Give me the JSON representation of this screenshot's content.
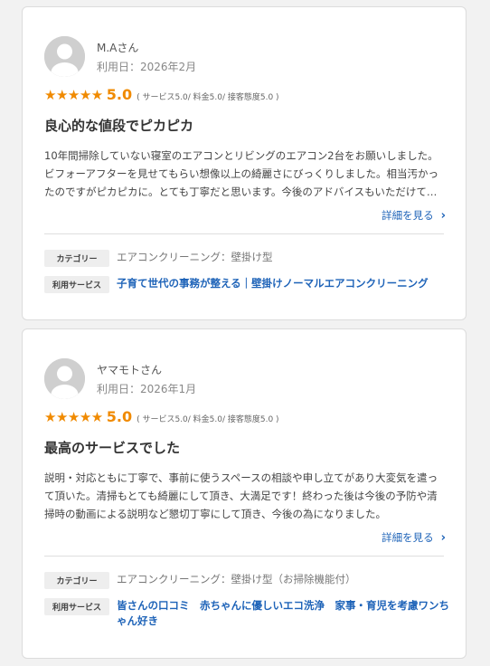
{
  "reviews": [
    {
      "name": "M.Aさん",
      "date": "利用日：2026年2月",
      "stars": "★★★★★",
      "score": "5.0",
      "sub_scores": "( サービス5.0/ 料金5.0/ 接客態度5.0 )",
      "title": "良心的な値段でピカピカ",
      "body": "10年間掃除していない寝室のエアコンとリビングのエアコン2台をお願いしました。ビフォーアフターを見せてもらい想像以上の綺麗さにびっくりしました。相当汚かったのですがピカピカに。とても丁寧だと思います。今後のアドバイスもいただけて大変満足です。",
      "details_label": "詳細を見る",
      "category_tag": "カテゴリー",
      "category_value": "エアコンクリーニング：壁掛け型",
      "service_tag": "利用サービス",
      "services": [
        "子育て世代の事務が整える｜壁掛けノーマルエアコンクリーニング"
      ]
    },
    {
      "name": "ヤマモトさん",
      "date": "利用日：2026年1月",
      "stars": "★★★★★",
      "score": "5.0",
      "sub_scores": "( サービス5.0/ 料金5.0/ 接客態度5.0 )",
      "title": "最高のサービスでした",
      "body": "説明・対応ともに丁寧で、事前に使うスペースの相談や申し立てがあり大変気を遣って頂いた。清掃もとても綺麗にして頂き、大満足です！終わった後は今後の予防や清掃時の動画による説明など懇切丁寧にして頂き、今後の為になりました。",
      "details_label": "詳細を見る",
      "category_tag": "カテゴリー",
      "category_value": "エアコンクリーニング：壁掛け型（お掃除機能付）",
      "service_tag": "利用サービス",
      "services": [
        "皆さんの口コミ　赤ちゃんに優しいエコ洗浄　家事・育児を考慮ワンちゃん好き"
      ]
    }
  ],
  "colors": {
    "accent_star": "#f08a00",
    "link": "#1e63b8",
    "tag_bg": "#eeeeee"
  }
}
